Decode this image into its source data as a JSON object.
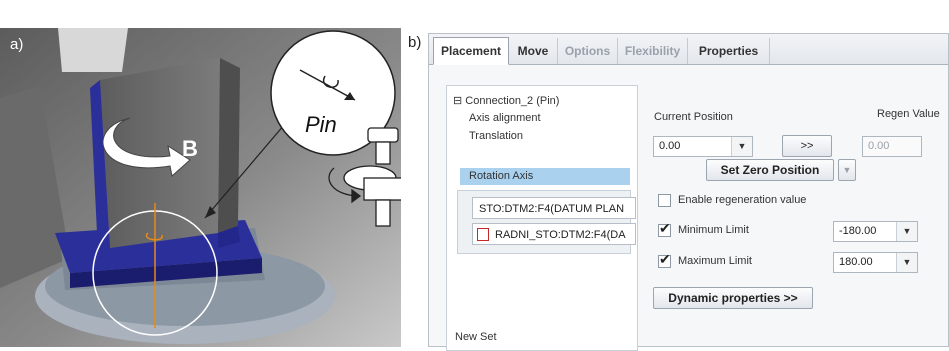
{
  "figure": {
    "label_a": "a)",
    "label_b": "b)",
    "pin_label": "Pin",
    "axis_label": "B"
  },
  "tabs": [
    {
      "label": "Placement",
      "state": "active"
    },
    {
      "label": "Move",
      "state": "normal"
    },
    {
      "label": "Options",
      "state": "disabled"
    },
    {
      "label": "Flexibility",
      "state": "disabled"
    },
    {
      "label": "Properties",
      "state": "normal"
    }
  ],
  "tree": {
    "root": "Connection_2 (Pin)",
    "items": [
      "Axis alignment",
      "Translation",
      "Rotation Axis"
    ],
    "selected": "Rotation Axis",
    "references": [
      "STO:DTM2:F4(DATUM PLAN",
      "RADNI_STO:DTM2:F4(DA"
    ],
    "new_set": "New Set",
    "expander": "⊟"
  },
  "position": {
    "current_label": "Current Position",
    "current_value": "0.00",
    "arrow_button": ">>",
    "regen_label": "Regen Value",
    "regen_value": "0.00",
    "set_zero_button": "Set Zero Position",
    "enable_regen_label": "Enable regeneration value",
    "enable_regen_checked": false,
    "min_label": "Minimum Limit",
    "min_checked": true,
    "min_value": "-180.00",
    "max_label": "Maximum Limit",
    "max_checked": true,
    "max_value": "180.00",
    "dynamic_button": "Dynamic properties >>"
  },
  "colors": {
    "accent_blue": "#2b2f9a",
    "selection": "#aad2ef",
    "axis_orange": "#e58a1c"
  }
}
